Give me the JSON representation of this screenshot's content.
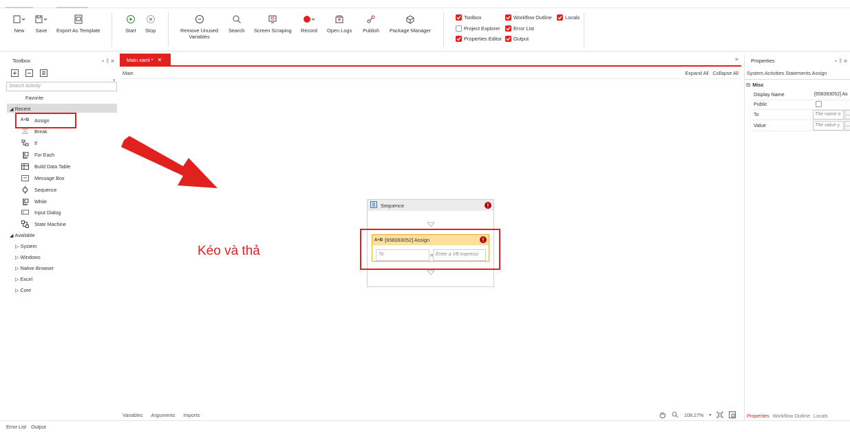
{
  "ribbon": {
    "buttons": [
      {
        "id": "new",
        "label": "New",
        "icon": "new-file-icon"
      },
      {
        "id": "save",
        "label": "Save",
        "icon": "save-icon"
      },
      {
        "id": "export",
        "label": "Export As Template",
        "icon": "export-template-icon"
      },
      {
        "id": "start",
        "label": "Start",
        "icon": "play-icon"
      },
      {
        "id": "stop",
        "label": "Stop",
        "icon": "stop-icon"
      },
      {
        "id": "remove_unused",
        "label": "Remove Unused\nVariables",
        "icon": "remove-icon"
      },
      {
        "id": "search",
        "label": "Search",
        "icon": "search-icon"
      },
      {
        "id": "screen_scraping",
        "label": "Screen Scraping",
        "icon": "screen-icon"
      },
      {
        "id": "record",
        "label": "Record",
        "icon": "record-icon"
      },
      {
        "id": "open_logs",
        "label": "Open Logs",
        "icon": "logs-icon"
      },
      {
        "id": "publish",
        "label": "Publish",
        "icon": "publish-icon"
      },
      {
        "id": "package_manager",
        "label": "Package Manager",
        "icon": "package-icon"
      }
    ],
    "checkboxes": [
      {
        "label": "Toolbox",
        "checked": true
      },
      {
        "label": "Workflow Outline",
        "checked": true
      },
      {
        "label": "Locals",
        "checked": true
      },
      {
        "label": "Project Explorer",
        "checked": false
      },
      {
        "label": "Error List",
        "checked": true
      },
      {
        "label": "Properties Editor",
        "checked": true
      },
      {
        "label": "Output",
        "checked": true
      }
    ]
  },
  "toolbox": {
    "title": "Toolbox",
    "pin_controls": "▾ ᚱ ✕",
    "search_placeholder": "Search Activity",
    "favorite": "Favorite",
    "recent_group": "Recent",
    "recent_items": [
      {
        "label": "Assign",
        "icon": "assign-icon"
      },
      {
        "label": "Break",
        "icon": "break-icon"
      },
      {
        "label": "If",
        "icon": "if-icon"
      },
      {
        "label": "For Each",
        "icon": "foreach-icon"
      },
      {
        "label": "Build Data Table",
        "icon": "datatable-icon"
      },
      {
        "label": "Message Box",
        "icon": "messagebox-icon"
      },
      {
        "label": "Sequence",
        "icon": "sequence-icon"
      },
      {
        "label": "While",
        "icon": "while-icon"
      },
      {
        "label": "Input Dialog",
        "icon": "inputdialog-icon"
      },
      {
        "label": "State Machine",
        "icon": "statemachine-icon"
      }
    ],
    "available_group": "Available",
    "available_items": [
      "System",
      "Windows",
      "Native Browser",
      "Excel",
      "Core"
    ]
  },
  "designer": {
    "tab_label": "Main.xaml *",
    "breadcrumb": "Main",
    "expand_all": "Expand All",
    "collapse_all": "Collapse All",
    "sequence_title": "Sequence",
    "assign_title": "[658393052] Assign",
    "assign_to_placeholder": "To",
    "assign_equals": "=",
    "assign_value_placeholder": "Enter a VB expressi",
    "annotation": "Kéo và thả",
    "bottom_tabs": [
      "Variables",
      "Arguments",
      "Imports"
    ],
    "zoom": "108.27%"
  },
  "properties": {
    "title": "Properties",
    "pin_controls": "▾ ᚱ ✕",
    "type_name": "System.Activities.Statements.Assign",
    "category": "Misc",
    "rows": [
      {
        "name": "Display Name",
        "value": "[658393052] As"
      },
      {
        "name": "Public",
        "value": ""
      },
      {
        "name": "To",
        "value": "The name o"
      },
      {
        "name": "Value",
        "value": "The value y"
      }
    ],
    "bottom_tabs": [
      "Properties",
      "Workflow Outline",
      "Locals"
    ]
  },
  "status_bar": {
    "tabs": [
      "Error List",
      "Output"
    ]
  },
  "colors": {
    "accent": "#e1211d",
    "error": "#b3080c",
    "assign_header": "#fcdf9a"
  }
}
